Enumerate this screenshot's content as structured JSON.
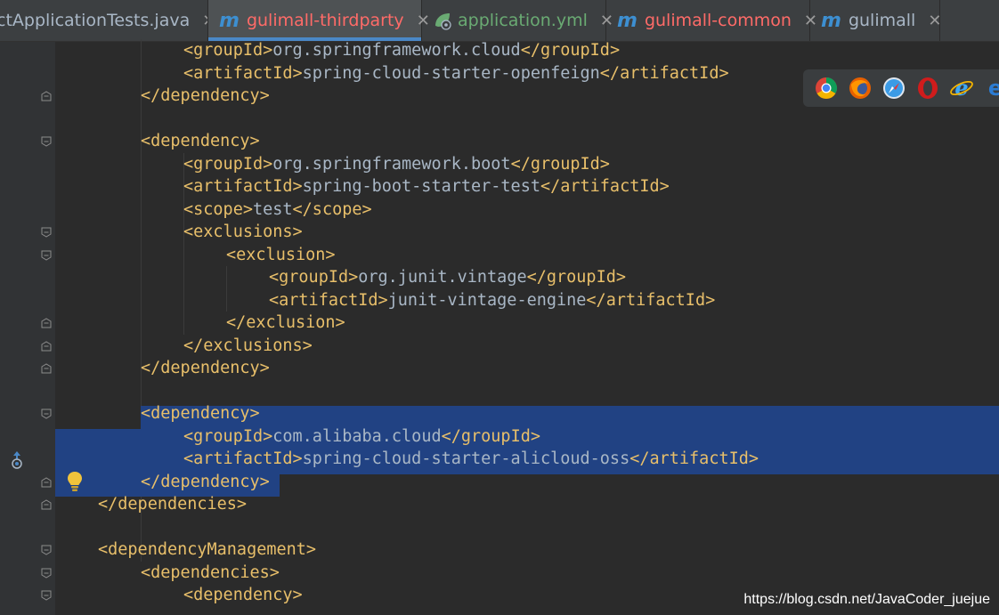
{
  "tabs": [
    {
      "label": "ctApplicationTests.java",
      "icon": "java-file-icon",
      "color": "#a9b7c6",
      "active": false
    },
    {
      "label": "gulimall-thirdparty",
      "icon": "maven-icon",
      "color": "#ff6b68",
      "active": true
    },
    {
      "label": "application.yml",
      "icon": "spring-leaf-icon",
      "color": "#6aab73",
      "active": false
    },
    {
      "label": "gulimall-common",
      "icon": "maven-icon",
      "color": "#ff6b68",
      "active": false
    },
    {
      "label": "gulimall",
      "icon": "maven-icon",
      "color": "#a9b7c6",
      "active": false
    }
  ],
  "close_glyph": "✕",
  "colors": {
    "tag": "#e8bf6a",
    "text": "#a9b7c6",
    "selection": "#214283",
    "background": "#2b2b2b",
    "gutter": "#313335",
    "active_tab_underline": "#4a88c7"
  },
  "code_lines": [
    {
      "indent": 2,
      "tokens": [
        {
          "t": "tag",
          "v": "<groupId>"
        },
        {
          "t": "txt",
          "v": "org.springframework.cloud"
        },
        {
          "t": "tag",
          "v": "</groupId>"
        }
      ]
    },
    {
      "indent": 2,
      "tokens": [
        {
          "t": "tag",
          "v": "<artifactId>"
        },
        {
          "t": "txt",
          "v": "spring-cloud-starter-openfeign"
        },
        {
          "t": "tag",
          "v": "</artifactId>"
        }
      ]
    },
    {
      "indent": 1,
      "tokens": [
        {
          "t": "tag",
          "v": "</dependency>"
        }
      ]
    },
    {
      "indent": 0,
      "tokens": []
    },
    {
      "indent": 1,
      "tokens": [
        {
          "t": "tag",
          "v": "<dependency>"
        }
      ]
    },
    {
      "indent": 2,
      "tokens": [
        {
          "t": "tag",
          "v": "<groupId>"
        },
        {
          "t": "txt",
          "v": "org.springframework.boot"
        },
        {
          "t": "tag",
          "v": "</groupId>"
        }
      ]
    },
    {
      "indent": 2,
      "tokens": [
        {
          "t": "tag",
          "v": "<artifactId>"
        },
        {
          "t": "txt",
          "v": "spring-boot-starter-test"
        },
        {
          "t": "tag",
          "v": "</artifactId>"
        }
      ]
    },
    {
      "indent": 2,
      "tokens": [
        {
          "t": "tag",
          "v": "<scope>"
        },
        {
          "t": "txt",
          "v": "test"
        },
        {
          "t": "tag",
          "v": "</scope>"
        }
      ]
    },
    {
      "indent": 2,
      "tokens": [
        {
          "t": "tag",
          "v": "<exclusions>"
        }
      ]
    },
    {
      "indent": 3,
      "tokens": [
        {
          "t": "tag",
          "v": "<exclusion>"
        }
      ]
    },
    {
      "indent": 4,
      "tokens": [
        {
          "t": "tag",
          "v": "<groupId>"
        },
        {
          "t": "txt",
          "v": "org.junit.vintage"
        },
        {
          "t": "tag",
          "v": "</groupId>"
        }
      ]
    },
    {
      "indent": 4,
      "tokens": [
        {
          "t": "tag",
          "v": "<artifactId>"
        },
        {
          "t": "txt",
          "v": "junit-vintage-engine"
        },
        {
          "t": "tag",
          "v": "</artifactId>"
        }
      ]
    },
    {
      "indent": 3,
      "tokens": [
        {
          "t": "tag",
          "v": "</exclusion>"
        }
      ]
    },
    {
      "indent": 2,
      "tokens": [
        {
          "t": "tag",
          "v": "</exclusions>"
        }
      ]
    },
    {
      "indent": 1,
      "tokens": [
        {
          "t": "tag",
          "v": "</dependency>"
        }
      ]
    },
    {
      "indent": 0,
      "tokens": []
    },
    {
      "indent": 1,
      "tokens": [
        {
          "t": "tag",
          "v": "<dependency>"
        }
      ]
    },
    {
      "indent": 2,
      "tokens": [
        {
          "t": "tag",
          "v": "<groupId>"
        },
        {
          "t": "txt",
          "v": "com.alibaba.cloud"
        },
        {
          "t": "tag",
          "v": "</groupId>"
        }
      ]
    },
    {
      "indent": 2,
      "tokens": [
        {
          "t": "tag",
          "v": "<artifactId>"
        },
        {
          "t": "txt",
          "v": "spring-cloud-starter-alicloud-oss"
        },
        {
          "t": "tag",
          "v": "</artifactId>"
        }
      ]
    },
    {
      "indent": 1,
      "tokens": [
        {
          "t": "tag",
          "v": "</dependency>"
        }
      ]
    },
    {
      "indent": 0,
      "tokens": [
        {
          "t": "tag",
          "v": "</dependencies>"
        }
      ]
    },
    {
      "indent": 0,
      "tokens": []
    },
    {
      "indent": 0,
      "tokens": [
        {
          "t": "tag",
          "v": "<dependencyManagement>"
        }
      ]
    },
    {
      "indent": 1,
      "tokens": [
        {
          "t": "tag",
          "v": "<dependencies>"
        }
      ]
    },
    {
      "indent": 2,
      "tokens": [
        {
          "t": "tag",
          "v": "<dependency>"
        }
      ]
    }
  ],
  "browser_icons": [
    "chrome-icon",
    "firefox-icon",
    "safari-icon",
    "opera-icon",
    "ie-icon",
    "edge-icon"
  ],
  "watermark": "https://blog.csdn.net/JavaCoder_juejue"
}
